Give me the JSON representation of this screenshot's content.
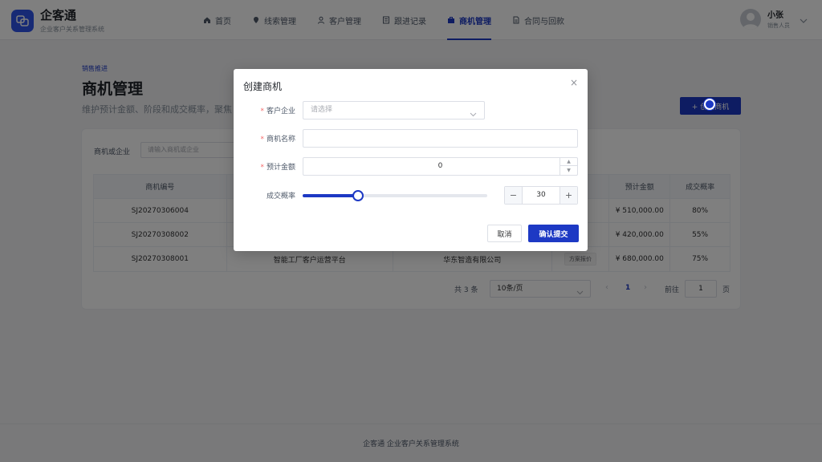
{
  "app": {
    "name": "企客通",
    "subtitle": "企业客户关系管理系统"
  },
  "nav": {
    "items": [
      {
        "label": "首页",
        "icon": "home-icon"
      },
      {
        "label": "线索管理",
        "icon": "pin-icon"
      },
      {
        "label": "客户管理",
        "icon": "user-icon"
      },
      {
        "label": "跟进记录",
        "icon": "record-icon"
      },
      {
        "label": "商机管理",
        "icon": "briefcase-icon",
        "active": true
      },
      {
        "label": "合同与回款",
        "icon": "document-icon"
      }
    ]
  },
  "user": {
    "name": "小张",
    "role": "销售人员"
  },
  "page": {
    "breadcrumb": "销售推进",
    "title": "商机管理",
    "description": "维护预计金额、阶段和成交概率，聚焦",
    "create_label": "+ 创建商机"
  },
  "filter": {
    "label": "商机或企业",
    "placeholder": "请输入商机或企业"
  },
  "table": {
    "headers": [
      "商机编号",
      "",
      "",
      "",
      "预计金额",
      "成交概率"
    ],
    "rows": [
      {
        "id": "SJ20270306004",
        "name": "",
        "company": "",
        "stage": "",
        "amount": "¥ 510,000.00",
        "prob": "80%"
      },
      {
        "id": "SJ20270308002",
        "name": "",
        "company": "",
        "stage": "",
        "amount": "¥ 420,000.00",
        "prob": "55%"
      },
      {
        "id": "SJ20270308001",
        "name": "智能工厂客户运营平台",
        "company": "华东智造有限公司",
        "stage": "方案报价",
        "amount": "¥ 680,000.00",
        "prob": "75%"
      }
    ]
  },
  "pager": {
    "total": "共 3 条",
    "page_size": "10条/页",
    "current": "1",
    "goto_label": "前往",
    "goto_value": "1",
    "goto_unit": "页"
  },
  "footer": "企客通 企业客户关系管理系统",
  "dialog": {
    "title": "创建商机",
    "close": "×",
    "fields": {
      "company": {
        "label": "客户企业",
        "placeholder": "请选择"
      },
      "name": {
        "label": "商机名称",
        "value": ""
      },
      "amount": {
        "label": "预计金额",
        "value": "0"
      },
      "probability": {
        "label": "成交概率",
        "value": "30",
        "percent": 30,
        "minus": "−",
        "plus": "+"
      }
    },
    "cancel": "取消",
    "submit": "确认提交"
  },
  "colors": {
    "primary": "#1d39c4",
    "required": "#f56c6c"
  }
}
